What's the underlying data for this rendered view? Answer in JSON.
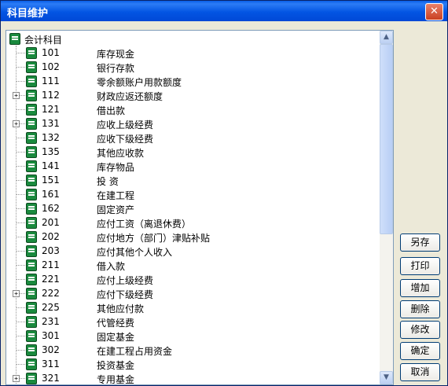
{
  "window": {
    "title": "科目维护",
    "close_glyph": "✕"
  },
  "tree": {
    "root_label": "会计科目",
    "items": [
      {
        "code": "101",
        "name": "库存现金",
        "expandable": false
      },
      {
        "code": "102",
        "name": "银行存款",
        "expandable": false
      },
      {
        "code": "111",
        "name": "零余额账户用款额度",
        "expandable": false
      },
      {
        "code": "112",
        "name": "财政应返还额度",
        "expandable": true
      },
      {
        "code": "121",
        "name": "借出款",
        "expandable": false
      },
      {
        "code": "131",
        "name": "应收上级经费",
        "expandable": true
      },
      {
        "code": "132",
        "name": "应收下级经费",
        "expandable": false
      },
      {
        "code": "135",
        "name": "其他应收款",
        "expandable": false
      },
      {
        "code": "141",
        "name": "库存物品",
        "expandable": false
      },
      {
        "code": "151",
        "name": "投 资",
        "expandable": false
      },
      {
        "code": "161",
        "name": "在建工程",
        "expandable": false
      },
      {
        "code": "162",
        "name": "固定资产",
        "expandable": false
      },
      {
        "code": "201",
        "name": "应付工资（离退休费）",
        "expandable": false
      },
      {
        "code": "202",
        "name": "应付地方（部门）津贴补贴",
        "expandable": false
      },
      {
        "code": "203",
        "name": "应付其他个人收入",
        "expandable": false
      },
      {
        "code": "211",
        "name": "借入款",
        "expandable": false
      },
      {
        "code": "221",
        "name": "应付上级经费",
        "expandable": false
      },
      {
        "code": "222",
        "name": "应付下级经费",
        "expandable": true
      },
      {
        "code": "225",
        "name": "其他应付款",
        "expandable": false
      },
      {
        "code": "231",
        "name": "代管经费",
        "expandable": false
      },
      {
        "code": "301",
        "name": "固定基金",
        "expandable": false
      },
      {
        "code": "302",
        "name": "在建工程占用资金",
        "expandable": false
      },
      {
        "code": "311",
        "name": "投资基金",
        "expandable": false
      },
      {
        "code": "321",
        "name": "专用基金",
        "expandable": true
      }
    ]
  },
  "scrollbar": {
    "up_glyph": "▲",
    "down_glyph": "▼"
  },
  "buttons": {
    "save_as": "另存",
    "print": "打印",
    "add": "增加",
    "delete": "删除",
    "modify": "修改",
    "confirm": "确定",
    "cancel": "取消"
  }
}
